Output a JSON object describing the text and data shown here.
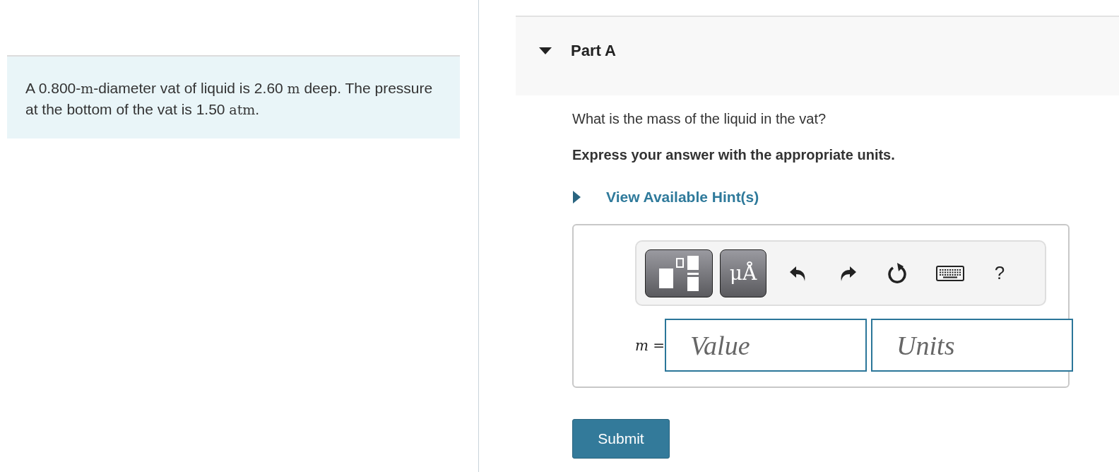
{
  "problem": {
    "segments": [
      {
        "kind": "text",
        "text": "A 0.800-"
      },
      {
        "kind": "unit",
        "text": "m"
      },
      {
        "kind": "text",
        "text": "-diameter vat of liquid is 2.60 "
      },
      {
        "kind": "unit",
        "text": "m"
      },
      {
        "kind": "text",
        "text": " deep. The pressure at the bottom of the vat is 1.50 "
      },
      {
        "kind": "unit",
        "text": "atm"
      },
      {
        "kind": "text",
        "text": "."
      }
    ]
  },
  "part": {
    "title": "Part A",
    "expanded": true
  },
  "question": "What is the mass of the liquid in the vat?",
  "instruction": "Express your answer with the appropriate units.",
  "hint": {
    "label": "View Available Hint(s)",
    "expanded": false
  },
  "toolbar": [
    {
      "kind": "templates"
    },
    {
      "kind": "units",
      "label": "μÅ"
    },
    {
      "kind": "undo"
    },
    {
      "kind": "redo"
    },
    {
      "kind": "reset"
    },
    {
      "kind": "keyboard"
    },
    {
      "kind": "help",
      "label": "?"
    }
  ],
  "answer": {
    "variable": "m",
    "equals": "=",
    "value_placeholder": "Value",
    "units_placeholder": "Units"
  },
  "submit": "Submit"
}
